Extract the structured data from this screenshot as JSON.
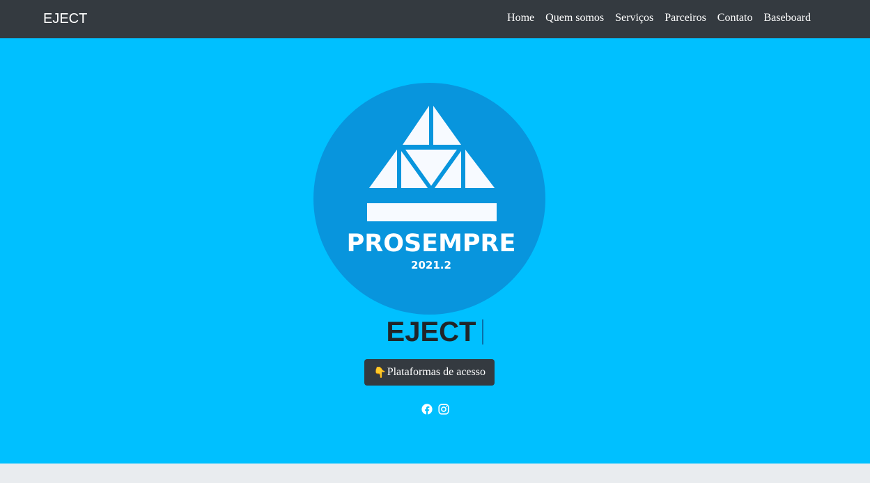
{
  "navbar": {
    "brand": "EJECT",
    "links": [
      {
        "label": "Home"
      },
      {
        "label": "Quem somos"
      },
      {
        "label": "Serviços"
      },
      {
        "label": "Parceiros"
      },
      {
        "label": "Contato"
      },
      {
        "label": "Baseboard"
      }
    ]
  },
  "hero": {
    "logo": {
      "title": "PROSEMPRE",
      "subtitle": "2021.2"
    },
    "title": "EJECT",
    "cta": {
      "emoji": "👇",
      "label": "Plataformas de acesso"
    },
    "social": [
      {
        "icon": "facebook-icon"
      },
      {
        "icon": "instagram-icon"
      }
    ]
  },
  "colors": {
    "navbar": "#343a40",
    "hero_bg": "#00c0ff",
    "logo_circle": "#0895dd",
    "footer": "#e9ecef"
  }
}
